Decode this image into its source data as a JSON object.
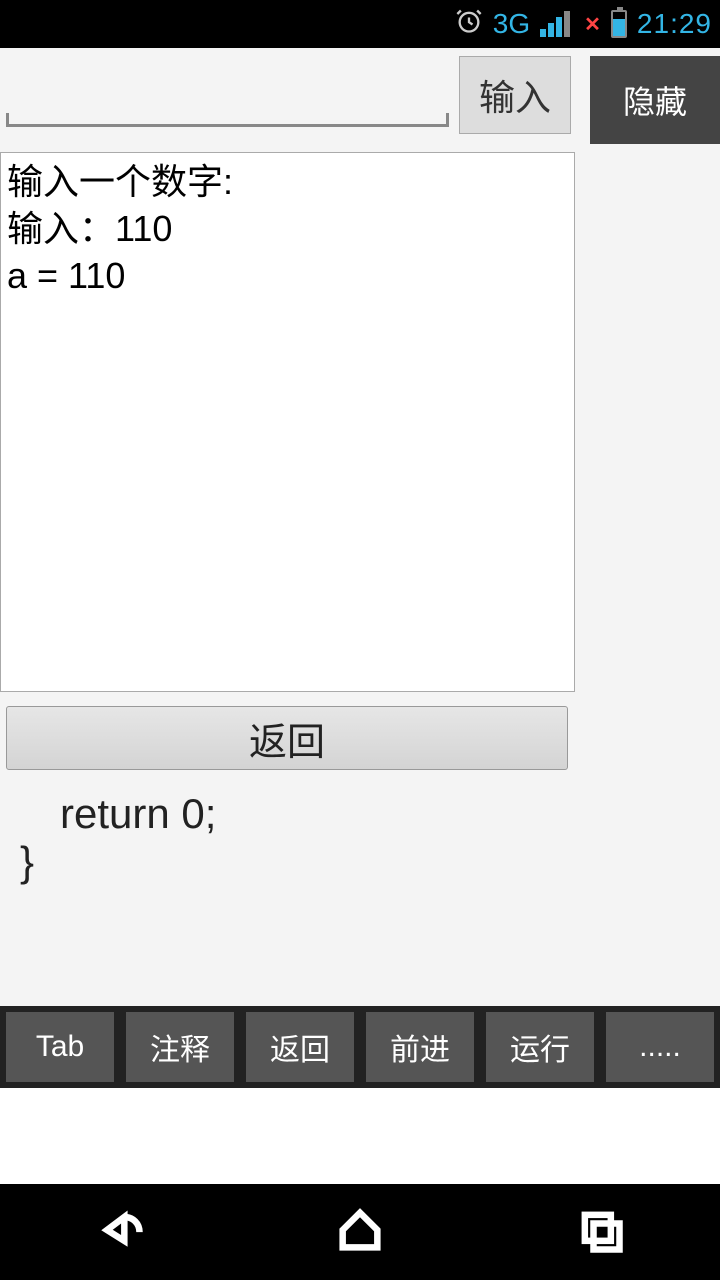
{
  "status": {
    "network_label": "3G",
    "time": "21:29"
  },
  "top": {
    "hide_label": "隐藏",
    "input_button_label": "输入",
    "input_value": ""
  },
  "output": {
    "lines": "输入一个数字:\n输入：110\na = 110"
  },
  "buttons": {
    "back_label": "返回"
  },
  "code": {
    "line1": "return 0;",
    "line2": "}"
  },
  "toolbar": {
    "items": [
      "Tab",
      "注释",
      "返回",
      "前进",
      "运行",
      "....."
    ]
  }
}
